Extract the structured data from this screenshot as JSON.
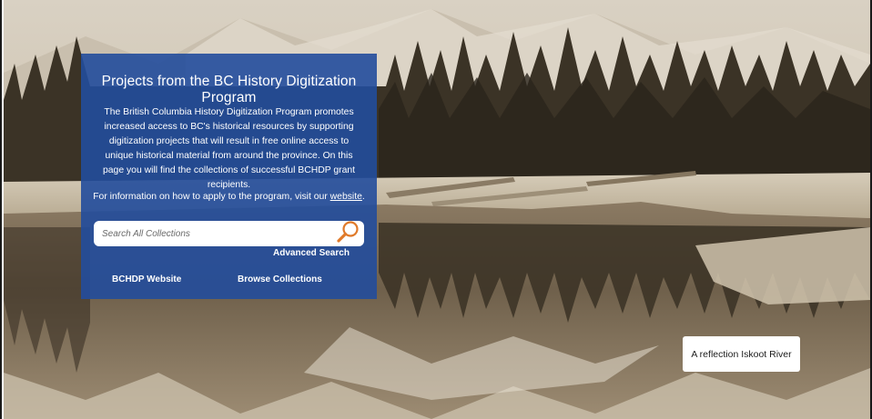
{
  "panel": {
    "title": "Projects from the BC History Digitization Program",
    "description": "The British Columbia History Digitization Program promotes increased access to BC's historical resources by supporting digitization projects that will result in free online access to unique historical material from around the province. On this page you will find the collections of successful BCHDP grant recipients.",
    "apply_prefix": "For information on how to apply to the program, visit our ",
    "apply_link": "website",
    "apply_suffix": "."
  },
  "search": {
    "placeholder": "Search All Collections",
    "value": "",
    "icon": "magnifier-icon",
    "advanced_label": "Advanced Search"
  },
  "links": {
    "bchdp_website": "BCHDP Website",
    "browse_collections": "Browse Collections"
  },
  "caption": {
    "text": "A reflection Iskoot River"
  },
  "colors": {
    "panel_bg": "#224c9c",
    "search_icon": "#e07a2a",
    "photo_sepia": "#b8a488"
  }
}
